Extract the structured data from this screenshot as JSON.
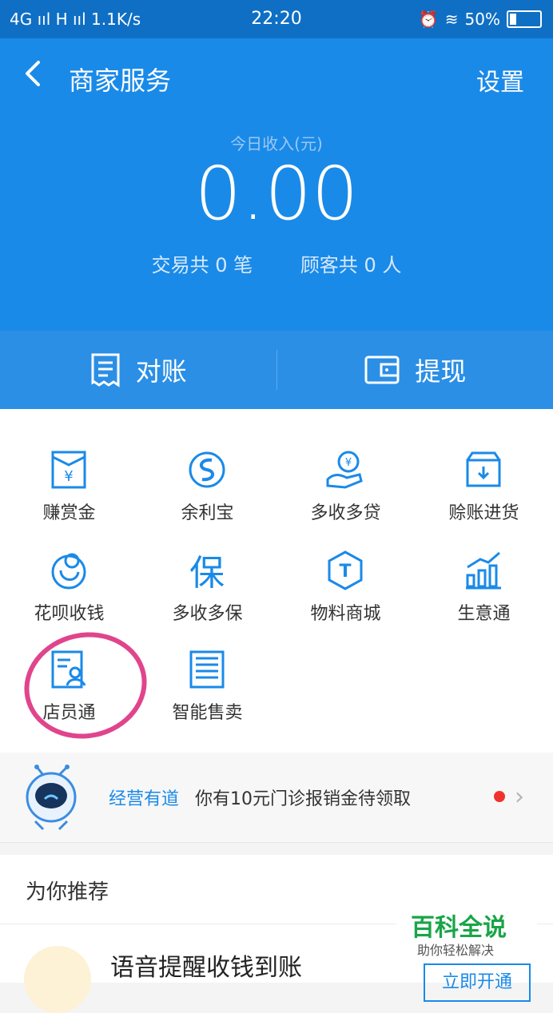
{
  "status_bar": {
    "network": "4G ııl H ııl 1.1K/s",
    "time": "22:20",
    "battery": "50%"
  },
  "header": {
    "back_label": "<",
    "title": "商家服务",
    "settings": "设置",
    "income_label": "今日收入(元)",
    "income_value": "0.00",
    "transactions": "交易共 0 笔",
    "customers": "顾客共 0 人"
  },
  "actions": {
    "reconcile": "对账",
    "withdraw": "提现"
  },
  "services": [
    {
      "label": "赚赏金",
      "icon": "envelope-yuan-icon"
    },
    {
      "label": "余利宝",
      "icon": "swirl-icon"
    },
    {
      "label": "多收多贷",
      "icon": "hand-money-icon"
    },
    {
      "label": "赊账进货",
      "icon": "box-icon"
    },
    {
      "label": "花呗收钱",
      "icon": "huabei-icon"
    },
    {
      "label": "多收多保",
      "icon": "bao-icon"
    },
    {
      "label": "物料商城",
      "icon": "t-badge-icon"
    },
    {
      "label": "生意通",
      "icon": "bar-chart-icon"
    },
    {
      "label": "店员通",
      "icon": "staff-icon"
    },
    {
      "label": "智能售卖",
      "icon": "register-icon"
    }
  ],
  "notice": {
    "tag": "经营有道",
    "message": "你有10元门诊报销金待领取"
  },
  "recommend": {
    "title": "为你推荐",
    "item_title": "语音提醒收钱到账",
    "item_button": "立即开通"
  },
  "watermark": {
    "line1": "百科全说",
    "line2": "助你轻松解决"
  },
  "colors": {
    "brand_blue": "#1a8ae8",
    "highlight_pink": "#e0458c",
    "watermark_green": "#19a548"
  }
}
